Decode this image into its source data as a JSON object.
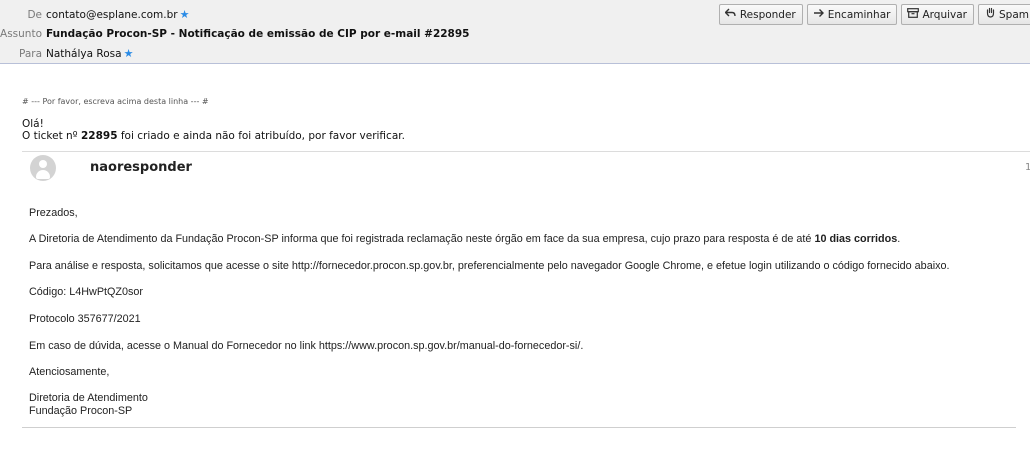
{
  "header": {
    "from_label": "De",
    "from_value": "contato@esplane.com.br",
    "subject_label": "Assunto",
    "subject_value": "Fundação Procon-SP - Notificação de emissão de CIP por e-mail #22895",
    "to_label": "Para",
    "to_value": "Nathálya Rosa",
    "star_glyph": "★"
  },
  "toolbar": {
    "reply": "Responder",
    "forward": "Encaminhar",
    "archive": "Arquivar",
    "spam": "Spam"
  },
  "body": {
    "separator": "# --- Por favor, escreva acima desta linha --- #",
    "greeting": "Olá!",
    "ticket_pre": "O ticket nº ",
    "ticket_num": "22895",
    "ticket_post": " foi criado e ainda não foi atribuído, por favor verificar.",
    "sender_name": "naoresponder",
    "edge_number": "1",
    "msg_greeting": "Prezados,",
    "msg_p1_pre": "A Diretoria de Atendimento da Fundação Procon-SP informa que foi registrada reclamação neste órgão em face da sua empresa, cujo prazo para resposta é de até ",
    "msg_p1_bold": "10 dias corridos",
    "msg_p1_post": ".",
    "msg_p2": "Para análise e resposta, solicitamos que acesse o site http://fornecedor.procon.sp.gov.br, preferencialmente pelo navegador Google Chrome, e efetue login utilizando o código fornecido abaixo.",
    "msg_code": "Código: L4HwPtQZ0sor",
    "msg_protocol": "Protocolo 357677/2021",
    "msg_manual": "Em caso de dúvida, acesse o Manual do Fornecedor no link  https://www.procon.sp.gov.br/manual-do-fornecedor-si/.",
    "msg_regards": "Atenciosamente,",
    "sig_line1": "Diretoria de Atendimento",
    "sig_line2": "Fundação Procon-SP"
  }
}
